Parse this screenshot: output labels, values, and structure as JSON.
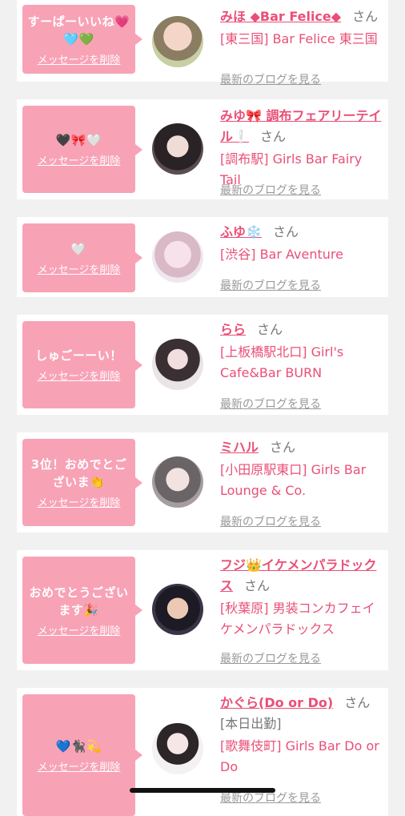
{
  "delete_label": "メッセージを削除",
  "blog_label": "最新のブログを見る",
  "san_label": "さん",
  "colors": {
    "background": "#f1f1f1",
    "bubble": "#f8a2b6",
    "name": "#ea4f77",
    "shop": "#ea4f77",
    "muted": "#999999"
  },
  "items": [
    {
      "message": "すーぱーいいね💗🩵💚",
      "name": "みほ ◆Bar Felice◆",
      "shop": "[東三国] Bar Felice 東三国"
    },
    {
      "message": "🖤🎀🤍",
      "name": "みゆ🎀 調布フェアリーテイル❕",
      "shop": "[調布駅] Girls Bar Fairy Tail"
    },
    {
      "message": "🤍",
      "name": "ふゆ❄️",
      "shop": "[渋谷] Bar Aventure"
    },
    {
      "message": "しゅごーーい！",
      "name": "らら",
      "shop": "[上板橋駅北口] Girl's Cafe&Bar BURN"
    },
    {
      "message": "3位！おめでとございま👏",
      "name": "ミハル",
      "shop": "[小田原駅東口] Girls Bar Lounge & Co."
    },
    {
      "message": "おめでとうございます🎉",
      "name": "フジ👑イケメンパラドックス",
      "shop": "[秋葉原] 男装コンカフェイケメンパラドックス"
    },
    {
      "message": "💙🐈‍⬛💫",
      "name": "かぐら(Do or Do)",
      "name_suffix": "[本日出勤]",
      "shop": "[歌舞伎町] Girls Bar Do or Do"
    }
  ]
}
